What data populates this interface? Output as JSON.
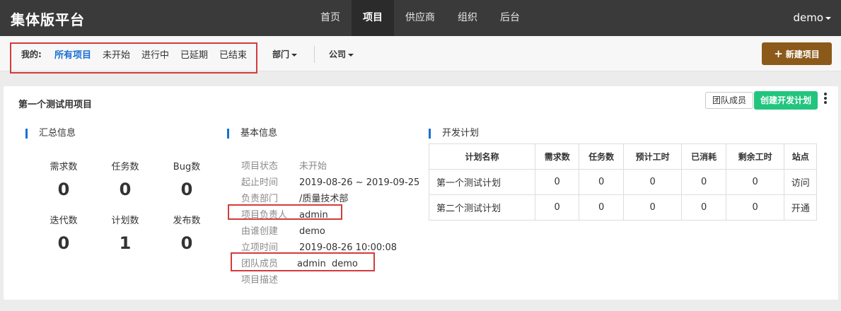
{
  "app": {
    "brand": "集体版平台",
    "user": "demo"
  },
  "nav": [
    "首页",
    "项目",
    "供应商",
    "组织",
    "后台"
  ],
  "filters": {
    "label": "我的:",
    "items": [
      "所有项目",
      "未开始",
      "进行中",
      "已延期",
      "已结束"
    ],
    "department": "部门",
    "company": "公司"
  },
  "new_project": "新建项目",
  "project": {
    "title": "第一个测试用项目",
    "members_btn": "团队成员",
    "create_plan_btn": "创建开发计划"
  },
  "summary": {
    "heading": "汇总信息",
    "stats": [
      {
        "label": "需求数",
        "value": "0"
      },
      {
        "label": "任务数",
        "value": "0"
      },
      {
        "label": "Bug数",
        "value": "0"
      },
      {
        "label": "迭代数",
        "value": "0"
      },
      {
        "label": "计划数",
        "value": "1"
      },
      {
        "label": "发布数",
        "value": "0"
      }
    ]
  },
  "basic": {
    "heading": "基本信息",
    "rows": [
      {
        "key": "项目状态",
        "value": "未开始"
      },
      {
        "key": "起止时间",
        "value": "2019-08-26 ~ 2019-09-25"
      },
      {
        "key": "负责部门",
        "value": "/质量技术部"
      },
      {
        "key": "项目负责人",
        "value": "admin"
      },
      {
        "key": "由谁创建",
        "value": "demo"
      },
      {
        "key": "立项时间",
        "value": "2019-08-26 10:00:08"
      },
      {
        "key": "团队成员",
        "value": "admin  demo"
      },
      {
        "key": "项目描述",
        "value": ""
      }
    ]
  },
  "plans": {
    "heading": "开发计划",
    "columns": [
      "计划名称",
      "需求数",
      "任务数",
      "预计工时",
      "已消耗",
      "剩余工时",
      "站点"
    ],
    "rows": [
      [
        "第一个测试计划",
        "0",
        "0",
        "0",
        "0",
        "0",
        "访问"
      ],
      [
        "第二个测试计划",
        "0",
        "0",
        "0",
        "0",
        "0",
        "开通"
      ]
    ]
  }
}
